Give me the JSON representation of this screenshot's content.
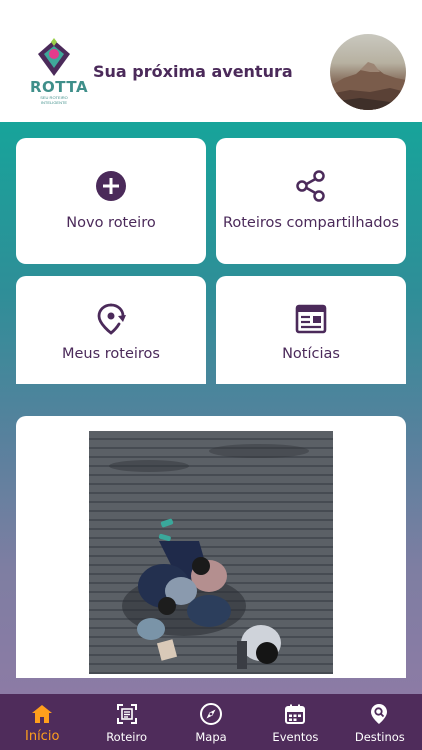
{
  "header": {
    "logo_text": "ROTTA",
    "logo_subtext": "SEU ROTEIRO INTELIGENTE",
    "title": "Sua próxima aventura",
    "avatar_icon": "user-avatar-landscape"
  },
  "colors": {
    "brand_purple": "#4b2a5a",
    "nav_background": "#4f2c5b",
    "active_orange": "#ff9f1c",
    "gradient_top": "#17a49a",
    "gradient_bottom": "#8c7ba5"
  },
  "tiles": [
    {
      "label": "Novo roteiro",
      "icon": "plus-circle-icon"
    },
    {
      "label": "Roteiros compartilhados",
      "icon": "share-icon"
    },
    {
      "label": "Meus roteiros",
      "icon": "location-refresh-icon"
    },
    {
      "label": "Notícias",
      "icon": "newspaper-icon"
    }
  ],
  "feature": {
    "image_icon": "photo-people-on-boardwalk"
  },
  "nav": {
    "items": [
      {
        "label": "Início",
        "icon": "home-icon",
        "active": true
      },
      {
        "label": "Roteiro",
        "icon": "scan-icon",
        "active": false
      },
      {
        "label": "Mapa",
        "icon": "compass-icon",
        "active": false
      },
      {
        "label": "Eventos",
        "icon": "calendar-icon",
        "active": false
      },
      {
        "label": "Destinos",
        "icon": "search-location-icon",
        "active": false
      }
    ]
  }
}
